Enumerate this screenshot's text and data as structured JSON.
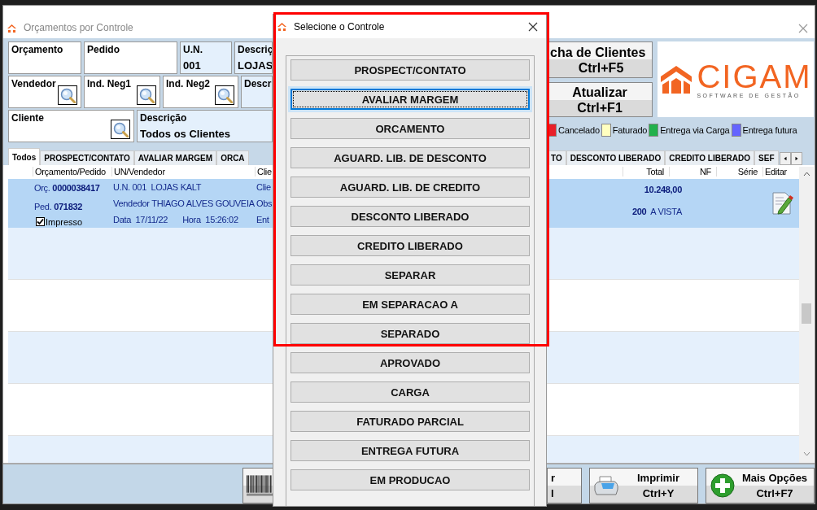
{
  "window": {
    "title": "Orçamentos por Controle"
  },
  "filters": [
    [
      {
        "label": "Orçamento",
        "kind": "input"
      },
      {
        "label": "Pedido",
        "kind": "input"
      },
      {
        "label": "U.N.",
        "value": "001",
        "kind": "display"
      },
      {
        "label": "Descriç",
        "value": "LOJAS",
        "kind": "display"
      }
    ],
    [
      {
        "label": "Vendedor",
        "kind": "search"
      },
      {
        "label": "Ind. Neg1",
        "kind": "search"
      },
      {
        "label": "Ind. Neg2",
        "kind": "search"
      },
      {
        "label": "Descr",
        "kind": "display"
      }
    ],
    [
      {
        "label": "Cliente",
        "kind": "search"
      },
      {
        "label": "Descrição",
        "value": "Todos os Clientes",
        "kind": "display"
      }
    ]
  ],
  "actions": [
    {
      "lines": [
        "cha de Clientes",
        "Ctrl+F5"
      ]
    },
    {
      "lines": [
        "Atualizar",
        "Ctrl+F1"
      ]
    }
  ],
  "logo": {
    "name": "CIGAM",
    "tagline": "SOFTWARE DE GESTÃO"
  },
  "legend": [
    {
      "label": "Cancelado",
      "color": "#e8202a"
    },
    {
      "label": "Faturado",
      "color": "#ffffc0"
    },
    {
      "label": "Entrega via Carga",
      "color": "#22b14c"
    },
    {
      "label": "Entrega futura",
      "color": "#6464ff"
    }
  ],
  "tabs": {
    "before_dialog": [
      {
        "label": "Todos",
        "selected": true
      },
      {
        "label": "PROSPECT/CONTATO",
        "selected": false
      },
      {
        "label": "AVALIAR MARGEM",
        "selected": false
      },
      {
        "label": "ORCA",
        "selected": false
      }
    ],
    "after_dialog": [
      {
        "label": "TO",
        "selected": false
      },
      {
        "label": "DESCONTO LIBERADO",
        "selected": false
      },
      {
        "label": "CREDITO LIBERADO",
        "selected": false
      },
      {
        "label": "SEF",
        "selected": false
      }
    ]
  },
  "table": {
    "columns_before_dialog": [
      "Orçamento/Pedido",
      "UN/Vendedor",
      "Clie"
    ],
    "columns_after_dialog": [
      "Total",
      "NF",
      "Série",
      "Editar"
    ],
    "rows": [
      {
        "selected": true,
        "orcamento": "Orç. **0000038417**",
        "pedido": "Ped. **071832**",
        "impresso": {
          "label": "Impresso",
          "checked": true
        },
        "un": "U.N. 001  LOJAS KALT",
        "vendedor": "Vendedor THIAGO ALVES GOUVEIA",
        "data": "Data  17/11/22",
        "hora": "Hora  15:26:02",
        "cliente_lines": [
          "Clie",
          "Obs",
          "Ent"
        ],
        "total": "10.248,00",
        "payment": "**200**  A VISTA"
      }
    ]
  },
  "bottom_buttons": [
    {
      "kind": "barcode"
    },
    {
      "kind": "plain",
      "lines": [
        "r",
        "l"
      ]
    },
    {
      "kind": "print",
      "lines": [
        "Imprimir",
        "Ctrl+Y"
      ]
    },
    {
      "kind": "add",
      "lines": [
        "Mais Opções",
        "Ctrl+F7"
      ]
    }
  ],
  "dialog": {
    "title": "Selecione o Controle",
    "options": [
      {
        "label": "PROSPECT/CONTATO",
        "selected": false
      },
      {
        "label": "AVALIAR MARGEM",
        "selected": true
      },
      {
        "label": "ORCAMENTO",
        "selected": false
      },
      {
        "label": "AGUARD. LIB. DE DESCONTO",
        "selected": false
      },
      {
        "label": "AGUARD. LIB. DE CREDITO",
        "selected": false
      },
      {
        "label": "DESCONTO LIBERADO",
        "selected": false
      },
      {
        "label": "CREDITO LIBERADO",
        "selected": false
      },
      {
        "label": "SEPARAR",
        "selected": false
      },
      {
        "label": "EM SEPARACAO A",
        "selected": false
      },
      {
        "label": "SEPARADO",
        "selected": false
      },
      {
        "label": "APROVADO",
        "selected": false
      },
      {
        "label": "CARGA",
        "selected": false
      },
      {
        "label": "FATURADO PARCIAL",
        "selected": false
      },
      {
        "label": "ENTREGA FUTURA",
        "selected": false
      },
      {
        "label": "EM PRODUCAO",
        "selected": false
      }
    ]
  }
}
